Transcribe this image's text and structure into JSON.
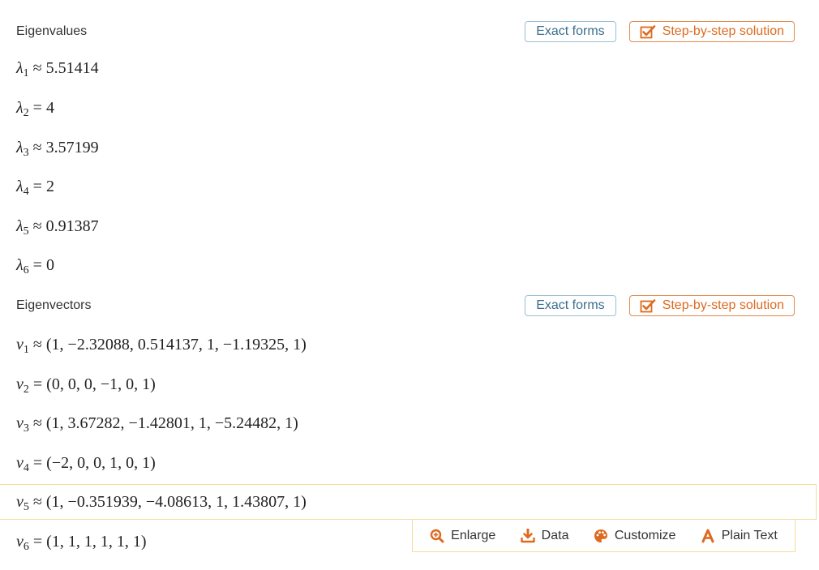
{
  "eigenvalues": {
    "title": "Eigenvalues",
    "exact_label": "Exact forms",
    "step_label": "Step-by-step solution",
    "items": [
      {
        "sym": "λ",
        "sub": "1",
        "rel": "≈",
        "val": "5.51414"
      },
      {
        "sym": "λ",
        "sub": "2",
        "rel": "=",
        "val": "4"
      },
      {
        "sym": "λ",
        "sub": "3",
        "rel": "≈",
        "val": "3.57199"
      },
      {
        "sym": "λ",
        "sub": "4",
        "rel": "=",
        "val": "2"
      },
      {
        "sym": "λ",
        "sub": "5",
        "rel": "≈",
        "val": "0.91387"
      },
      {
        "sym": "λ",
        "sub": "6",
        "rel": "=",
        "val": "0"
      }
    ]
  },
  "eigenvectors": {
    "title": "Eigenvectors",
    "exact_label": "Exact forms",
    "step_label": "Step-by-step solution",
    "items": [
      {
        "sym": "v",
        "sub": "1",
        "rel": "≈",
        "val": "(1, −2.32088, 0.514137, 1, −1.19325, 1)"
      },
      {
        "sym": "v",
        "sub": "2",
        "rel": "=",
        "val": "(0, 0, 0, −1, 0, 1)"
      },
      {
        "sym": "v",
        "sub": "3",
        "rel": "≈",
        "val": "(1, 3.67282, −1.42801, 1, −5.24482, 1)"
      },
      {
        "sym": "v",
        "sub": "4",
        "rel": "=",
        "val": "(−2, 0, 0, 1, 0, 1)"
      },
      {
        "sym": "v",
        "sub": "5",
        "rel": "≈",
        "val": "(1, −0.351939, −4.08613, 1, 1.43807, 1)"
      },
      {
        "sym": "v",
        "sub": "6",
        "rel": "=",
        "val": "(1, 1, 1, 1, 1, 1)"
      }
    ]
  },
  "hover_bar": {
    "enlarge": "Enlarge",
    "data": "Data",
    "customize": "Customize",
    "plain_text": "Plain Text"
  },
  "colors": {
    "exact_button": "#3b6e8f",
    "step_button": "#dd6a1f",
    "highlight_border": "#f1de9b"
  }
}
